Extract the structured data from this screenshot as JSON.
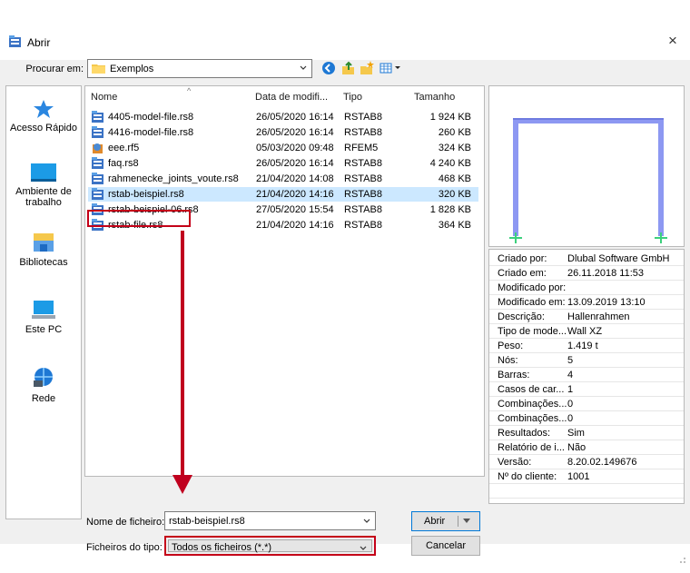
{
  "window": {
    "title": "Abrir",
    "close_glyph": "×"
  },
  "lookin": {
    "label": "Procurar em:",
    "value": "Exemplos"
  },
  "places": [
    {
      "label": "Acesso Rápido",
      "icon": "star-icon"
    },
    {
      "label": "Ambiente de trabalho",
      "icon": "desktop-icon"
    },
    {
      "label": "Bibliotecas",
      "icon": "library-icon"
    },
    {
      "label": "Este PC",
      "icon": "computer-icon"
    },
    {
      "label": "Rede",
      "icon": "network-icon"
    }
  ],
  "columns": {
    "name": "Nome",
    "date": "Data de modifi...",
    "type": "Tipo",
    "size": "Tamanho"
  },
  "files": [
    {
      "name": "4405-model-file.rs8",
      "date": "26/05/2020 16:14",
      "type": "RSTAB8",
      "size": "1 924 KB",
      "icon": "rstab-file-icon"
    },
    {
      "name": "4416-model-file.rs8",
      "date": "26/05/2020 16:14",
      "type": "RSTAB8",
      "size": "260 KB",
      "icon": "rstab-file-icon"
    },
    {
      "name": "eee.rf5",
      "date": "05/03/2020 09:48",
      "type": "RFEM5",
      "size": "324 KB",
      "icon": "rfem-file-icon"
    },
    {
      "name": "faq.rs8",
      "date": "26/05/2020 16:14",
      "type": "RSTAB8",
      "size": "4 240 KB",
      "icon": "rstab-file-icon"
    },
    {
      "name": "rahmenecke_joints_voute.rs8",
      "date": "21/04/2020 14:08",
      "type": "RSTAB8",
      "size": "468 KB",
      "icon": "rstab-file-icon"
    },
    {
      "name": "rstab-beispiel.rs8",
      "date": "21/04/2020 14:16",
      "type": "RSTAB8",
      "size": "320 KB",
      "icon": "rstab-file-icon",
      "selected": true
    },
    {
      "name": "rstab-beispiel-06.rs8",
      "date": "27/05/2020 15:54",
      "type": "RSTAB8",
      "size": "1 828 KB",
      "icon": "rstab-file-icon"
    },
    {
      "name": "rstab-file.rs8",
      "date": "21/04/2020 14:16",
      "type": "RSTAB8",
      "size": "364 KB",
      "icon": "rstab-file-icon"
    }
  ],
  "properties": [
    {
      "key": "Criado por:",
      "value": "Dlubal Software GmbH"
    },
    {
      "key": "Criado em:",
      "value": "26.11.2018 11:53"
    },
    {
      "key": "Modificado por:",
      "value": ""
    },
    {
      "key": "Modificado em:",
      "value": "13.09.2019 13:10"
    },
    {
      "key": "Descrição:",
      "value": "Hallenrahmen"
    },
    {
      "key": "Tipo de mode...",
      "value": "Wall XZ"
    },
    {
      "key": "Peso:",
      "value": "1.419 t"
    },
    {
      "key": "Nós:",
      "value": "5"
    },
    {
      "key": "Barras:",
      "value": "4"
    },
    {
      "key": "Casos de car...",
      "value": "1"
    },
    {
      "key": "Combinações...",
      "value": "0"
    },
    {
      "key": "Combinações...",
      "value": "0"
    },
    {
      "key": "Resultados:",
      "value": "Sim"
    },
    {
      "key": "Relatório de i...",
      "value": "Não"
    },
    {
      "key": "Versão:",
      "value": "8.20.02.149676"
    },
    {
      "key": "Nº do cliente:",
      "value": "1001"
    },
    {
      "key": "",
      "value": ""
    }
  ],
  "filename": {
    "label": "Nome de ficheiro:",
    "value": "rstab-beispiel.rs8"
  },
  "filetype": {
    "label": "Ficheiros do tipo:",
    "value": "Todos os ficheiros (*.*)"
  },
  "buttons": {
    "open": "Abrir",
    "cancel": "Cancelar"
  },
  "colors": {
    "selection": "#cce8ff",
    "highlight_red": "#c40018",
    "frame_member": "#8d98f2",
    "support": "#3cd07c"
  }
}
